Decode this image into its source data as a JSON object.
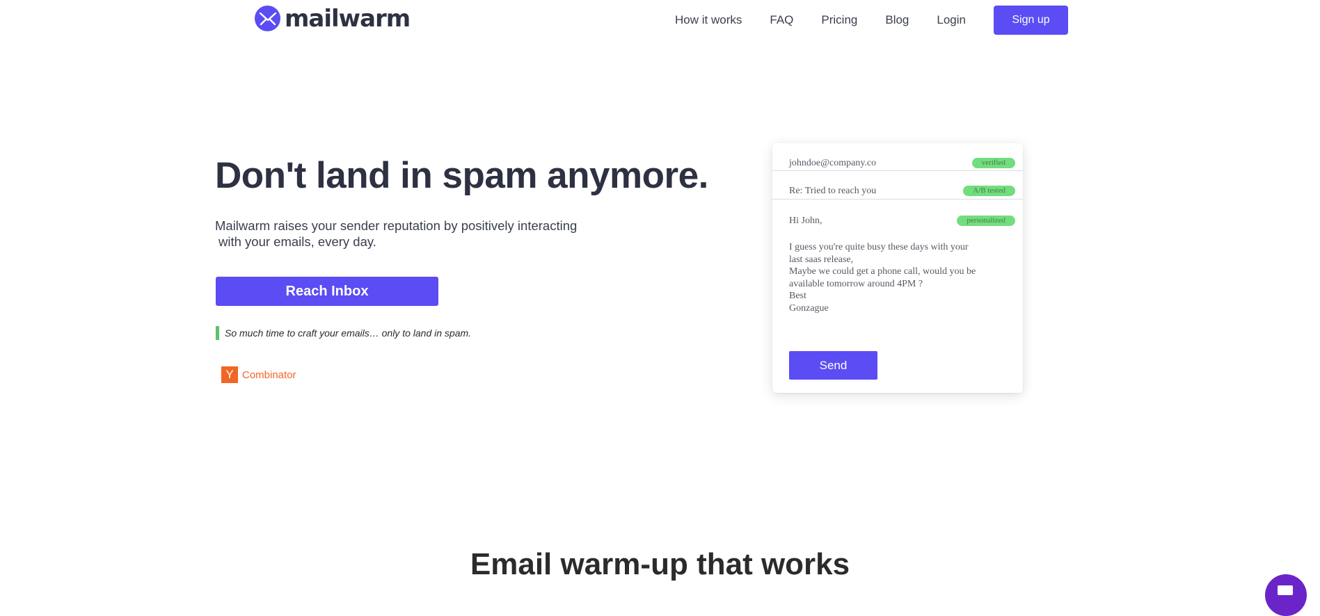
{
  "brand": {
    "name": "mailwarm",
    "accent": "#5b4cf4",
    "logo_icon": "envelope-chart-icon"
  },
  "nav": {
    "links": [
      "How it works",
      "FAQ",
      "Pricing",
      "Blog",
      "Login"
    ],
    "signup_label": "Sign up"
  },
  "hero": {
    "title": "Don't land in spam anymore.",
    "subtitle_line1": "Mailwarm raises your sender reputation by positively interacting",
    "subtitle_line2": "with your emails, every day.",
    "cta_label": "Reach Inbox",
    "quote": "So much time to craft your emails… only to land in spam.",
    "quote_color": "#5cc26a",
    "yc_letter": "Y",
    "yc_label": "Combinator",
    "yc_color": "#f26625"
  },
  "email_card": {
    "to": "johndoe@company.co",
    "to_badge": "verified",
    "subject": "Re: Tried to reach you",
    "subject_badge": "A/B tested",
    "greeting": "Hi John,",
    "greeting_badge": "personalized",
    "badge_color": "#72dd7d",
    "body_lines": [
      "I guess you're quite busy these days with your",
      "last saas release,",
      "Maybe we could get a phone call, would you be",
      "available tomorrow around 4PM ?",
      "Best",
      "Gonzague"
    ],
    "send_label": "Send"
  },
  "section2": {
    "title": "Email warm-up that works"
  },
  "chat": {
    "icon": "chat-icon",
    "color": "#6b24c8"
  }
}
